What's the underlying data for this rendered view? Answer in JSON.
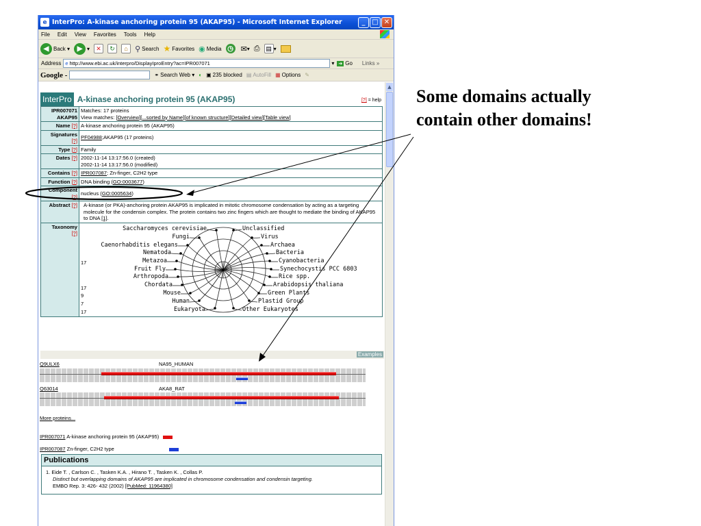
{
  "window": {
    "title": "InterPro: A-kinase anchoring protein 95 (AKAP95) - Microsoft Internet Explorer",
    "menu": [
      "File",
      "Edit",
      "View",
      "Favorites",
      "Tools",
      "Help"
    ],
    "toolbar": {
      "back": "Back",
      "search": "Search",
      "favorites": "Favorites",
      "media": "Media"
    },
    "address_label": "Address",
    "address": "http://www.ebi.ac.uk/interpro/DisplayIproEntry?ac=IPR007071",
    "go": "Go",
    "links": "Links »",
    "google": {
      "logo": "Google -",
      "search_web": "Search Web",
      "blocked": "235 blocked",
      "autofill": "AutoFill",
      "options": "Options"
    }
  },
  "entry": {
    "logo": "InterPro",
    "title": "A-kinase anchoring protein 95 (AKAP95)",
    "help": "[?]",
    "help_suffix": " = help",
    "accession": "IPR007071",
    "short_name": "AKAP95",
    "matches": "Matches: 17 proteins",
    "view_matches_label": "View matches: ",
    "view_matches_links": "[Overview][...sorted by Name][of known structure][Detailed view][Table view]",
    "q": "[?]",
    "rows": {
      "name": {
        "label": "Name",
        "value": "A-kinase anchoring protein 95 (AKAP95)"
      },
      "signatures": {
        "label": "Signatures",
        "link": "PF04988",
        "value": ";AKAP95 (17 proteins)"
      },
      "type": {
        "label": "Type",
        "value": "Family"
      },
      "dates": {
        "label": "Dates",
        "created": "2002-11-14 13:17:56.0 (created)",
        "modified": "2002-11-14 13:17:56.0 (modified)"
      },
      "contains": {
        "label": "Contains",
        "link": "IPR007087",
        "value": "; Zn-finger, C2H2 type"
      },
      "function": {
        "label": "Function",
        "value": "DNA binding (",
        "link": "GO:0003677",
        "end": ")"
      },
      "component": {
        "label": "Component",
        "value": "nucleus (",
        "link": "GO:0005634",
        "end": ")"
      },
      "abstract": {
        "label": "Abstract",
        "text": "A-kinase (or PKA)-anchoring protein AKAP95 is implicated in mitotic chromosome condensation by acting as a targeting molecule for the condensin complex. The protein contains two zinc fingers which are thought to mediate the binding of AKAP95 to DNA ",
        "ref": "[1]",
        "end": "."
      },
      "taxonomy": {
        "label": "Taxonomy"
      }
    },
    "taxonomy": {
      "counts": [
        "17",
        "17",
        "9",
        "7",
        "17"
      ],
      "left": [
        "Saccharomyces cerevisiae",
        "Fungi",
        "Caenorhabditis elegans",
        "Nematoda",
        "Metazoa",
        "Fruit Fly",
        "Arthropoda",
        "Chordata",
        "Mouse",
        "Human",
        "Eukaryota"
      ],
      "right": [
        "Unclassified",
        "Virus",
        "Archaea",
        "Bacteria",
        "Cyanobacteria",
        "Synechocystis PCC 6803",
        "Rice spp.",
        "Arabidopsis thaliana",
        "Green Plants",
        "Plastid Group",
        "Other Eukaryotes"
      ]
    },
    "examples": "Examples"
  },
  "proteins": [
    {
      "accession": "Q9ULX6",
      "name": "NA95_HUMAN"
    },
    {
      "accession": "Q63014",
      "name": "AKA8_RAT"
    }
  ],
  "more_proteins": "More proteins...",
  "legend": [
    {
      "accession": "IPR007071",
      "label": " A-kinase anchoring protein 95 (AKAP95)",
      "color": "#e01010"
    },
    {
      "accession": "IPR007087",
      "label": " Zn-finger, C2H2 type",
      "color": "#1c3ed8"
    }
  ],
  "publications": {
    "heading": "Publications",
    "authors": "1. Eide T. , Carlson C. , Tasken K.A. , Hirano T. , Tasken K. , Collas P.",
    "title": "Distinct but overlapping domains of AKAP95 are implicated in chromosome condensation and condensin targeting.",
    "journal": "EMBO Rep. 3: 426- 432 (2002) ",
    "pubmed": "[PubMed: 11964380]"
  },
  "annotation": {
    "line1": "Some domains actually",
    "line2": "contain other domains!"
  },
  "colors": {
    "accent": "#2b7a7a",
    "label_bg": "#d4eaea",
    "xp_title": "#0a4fd6"
  }
}
